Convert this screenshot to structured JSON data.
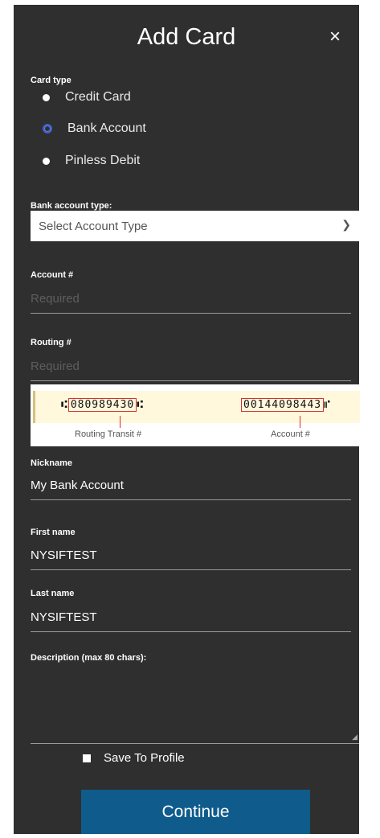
{
  "dialog": {
    "title": "Add Card",
    "close_glyph": "×"
  },
  "card_type": {
    "label": "Card type",
    "options": [
      {
        "label": "Credit Card",
        "checked": false
      },
      {
        "label": "Bank Account",
        "checked": true
      },
      {
        "label": "Pinless Debit",
        "checked": false
      }
    ]
  },
  "bank_account_type": {
    "label": "Bank account type:",
    "selected": "Select Account Type"
  },
  "account_number": {
    "label": "Account #",
    "placeholder": "Required"
  },
  "routing_number": {
    "label": "Routing #",
    "placeholder": "Required"
  },
  "check_diagram": {
    "routing_micr": "080989430",
    "account_micr": "00144098443",
    "routing_caption": "Routing Transit #",
    "account_caption": "Account #"
  },
  "nickname": {
    "label": "Nickname",
    "value": "My Bank Account"
  },
  "first_name": {
    "label": "First name",
    "value": "NYSIFTEST"
  },
  "last_name": {
    "label": "Last name",
    "value": "NYSIFTEST"
  },
  "description": {
    "label": "Description (max 80 chars):",
    "value": ""
  },
  "save_to_profile": {
    "label": "Save To Profile",
    "checked": false
  },
  "continue_button": {
    "label": "Continue"
  },
  "colors": {
    "panel": "#2f2f2f",
    "button": "#0f5b8c",
    "radio_accent": "#3c5fd6"
  }
}
